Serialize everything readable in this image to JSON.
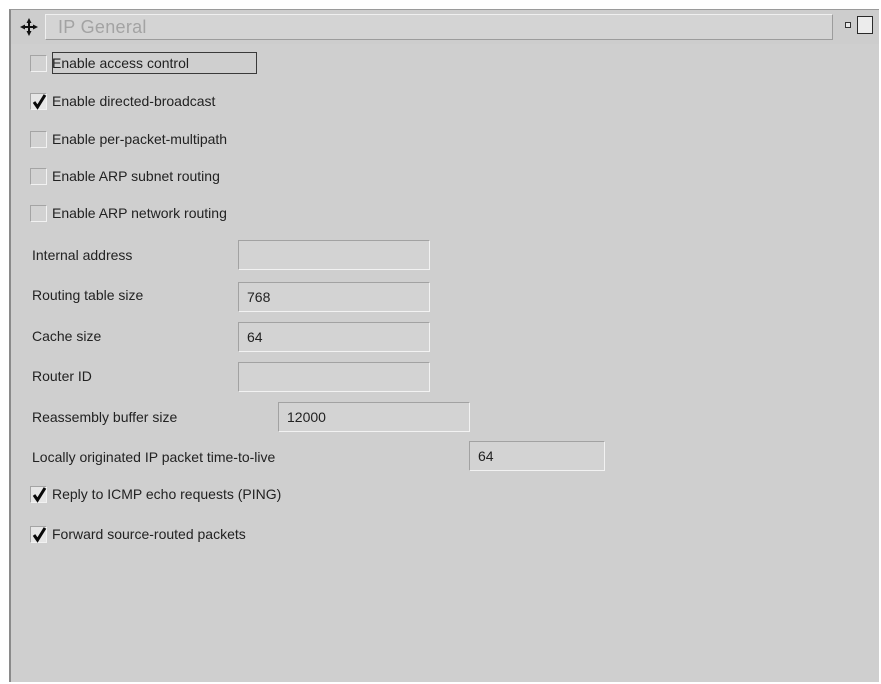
{
  "window": {
    "title": "IP General"
  },
  "checkboxes_top": [
    {
      "label": "Enable access control",
      "checked": false
    },
    {
      "label": "Enable directed-broadcast",
      "checked": true
    },
    {
      "label": "Enable per-packet-multipath",
      "checked": false
    },
    {
      "label": "Enable ARP subnet routing",
      "checked": false
    },
    {
      "label": "Enable ARP network routing",
      "checked": false
    }
  ],
  "fields": [
    {
      "label": "Internal address",
      "value": ""
    },
    {
      "label": "Routing table size",
      "value": "768"
    },
    {
      "label": "Cache size",
      "value": "64"
    },
    {
      "label": "Router ID",
      "value": ""
    },
    {
      "label": "Reassembly buffer size",
      "value": "12000"
    },
    {
      "label": "Locally originated IP packet time-to-live",
      "value": "64"
    }
  ],
  "checkboxes_bottom": [
    {
      "label": "Reply to ICMP echo requests (PING)",
      "checked": true
    },
    {
      "label": "Forward source-routed packets",
      "checked": true
    }
  ]
}
